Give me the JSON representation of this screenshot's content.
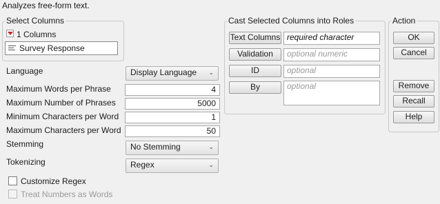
{
  "header": {
    "description": "Analyzes free-form text."
  },
  "select_columns": {
    "title": "Select Columns",
    "count_label": "1 Columns",
    "columns": [
      {
        "name": "Survey Response"
      }
    ]
  },
  "options": {
    "language": {
      "label": "Language",
      "value": "Display Language"
    },
    "max_words_per_phrase": {
      "label": "Maximum Words per Phrase",
      "value": "4"
    },
    "max_number_of_phrases": {
      "label": "Maximum Number of Phrases",
      "value": "5000"
    },
    "min_chars_per_word": {
      "label": "Minimum Characters per Word",
      "value": "1"
    },
    "max_chars_per_word": {
      "label": "Maximum Characters per Word",
      "value": "50"
    },
    "stemming": {
      "label": "Stemming",
      "value": "No Stemming"
    },
    "tokenizing": {
      "label": "Tokenizing",
      "value": "Regex"
    },
    "customize_regex": {
      "label": "Customize Regex",
      "checked": false
    },
    "treat_numbers_as_words": {
      "label": "Treat Numbers as Words",
      "checked": false,
      "enabled": false
    }
  },
  "cast_roles": {
    "title": "Cast Selected Columns into Roles",
    "roles": [
      {
        "button": "Text Columns",
        "placeholder": "required character"
      },
      {
        "button": "Validation",
        "placeholder": "optional numeric"
      },
      {
        "button": "ID",
        "placeholder": "optional"
      },
      {
        "button": "By",
        "placeholder": "optional"
      }
    ]
  },
  "action": {
    "title": "Action",
    "ok": "OK",
    "cancel": "Cancel",
    "remove": "Remove",
    "recall": "Recall",
    "help": "Help"
  }
}
